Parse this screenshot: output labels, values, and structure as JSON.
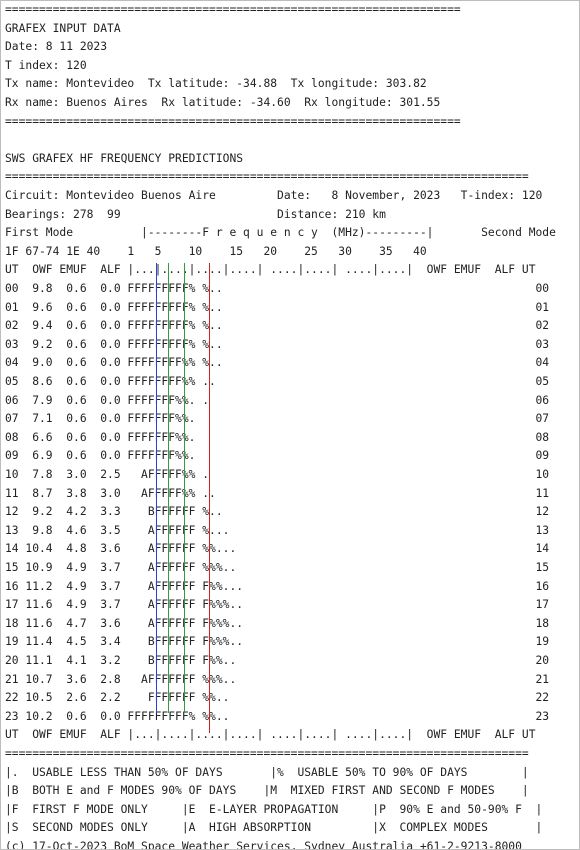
{
  "document": {
    "lines": [
      "===================================================================",
      "GRAFEX INPUT DATA",
      "Date: 8 11 2023",
      "T index: 120",
      "Tx name: Montevideo  Tx latitude: -34.88  Tx longitude: 303.82",
      "Rx name: Buenos Aires  Rx latitude: -34.60  Rx longitude: 301.55",
      "===================================================================",
      "",
      "SWS GRAFEX HF FREQUENCY PREDICTIONS",
      "=============================================================================",
      "Circuit: Montevideo Buenos Aire         Date:   8 November, 2023   T-index: 120",
      "Bearings: 278  99                       Distance: 210 km",
      "First Mode          |--------F r e q u e n c y  (MHz)---------|       Second Mode",
      "1F 67-74 1E 40    1   5    10    15   20    25   30    35   40",
      "UT  OWF EMUF  ALF |...|....|....|....| ....|....| ....|....|  OWF EMUF  ALF UT",
      "00  9.8  0.6  0.0 FFFFFFFFF% %..                                              00",
      "01  9.6  0.6  0.0 FFFFFFFFF% %..                                              01",
      "02  9.4  0.6  0.0 FFFFFFFFF% %..                                              02",
      "03  9.2  0.6  0.0 FFFFFFFFF% %..                                              03",
      "04  9.0  0.6  0.0 FFFFFFFF%% %..                                              04",
      "05  8.6  0.6  0.0 FFFFFFFF%% ..                                               05",
      "06  7.9  0.6  0.0 FFFFFFF%%. .                                                06",
      "07  7.1  0.6  0.0 FFFFFFF%%.                                                  07",
      "08  6.6  0.6  0.0 FFFFFFF%%.                                                  08",
      "09  6.9  0.6  0.0 FFFFFFF%%.                                                  09",
      "10  7.8  3.0  2.5   AFFFFF%% .                                                10",
      "11  8.7  3.8  3.0   AFFFFF%% ..                                               11",
      "12  9.2  4.2  3.3    BFFFFFF %..                                              12",
      "13  9.8  4.6  3.5    AFFFFFF %...                                             13",
      "14 10.4  4.8  3.6    AFFFFFF %%...                                            14",
      "15 10.9  4.9  3.7    AFFFFFF %%%..                                            15",
      "16 11.2  4.9  3.7    AFFFFFF F%%...                                           16",
      "17 11.6  4.9  3.7    AFFFFFF F%%%..                                           17",
      "18 11.6  4.7  3.6    AFFFFFF F%%%..                                           18",
      "19 11.4  4.5  3.4    BFFFFFF F%%%..                                           19",
      "20 11.1  4.1  3.2    BFFFFFF F%%..                                            20",
      "21 10.7  3.6  2.8   AFFFFFFF %%%..                                            21",
      "22 10.5  2.6  2.2    FFFFFFF %%..                                             22",
      "23 10.2  0.6  0.0 FFFFFFFFF% %%..                                             23",
      "UT  OWF EMUF  ALF |...|....|....|....| ....|....| ....|....|  OWF EMUF  ALF UT",
      "=============================================================================",
      "|.  USABLE LESS THAN 50% OF DAYS       |%  USABLE 50% TO 90% OF DAYS        |",
      "|B  BOTH E and F MODES 90% OF DAYS    |M  MIXED FIRST AND SECOND F MODES    |",
      "|F  FIRST F MODE ONLY     |E  E-LAYER PROPAGATION     |P  90% E and 50-90% F  |",
      "|S  SECOND MODES ONLY     |A  HIGH ABSORPTION         |X  COMPLEX MODES       |",
      "(c) 17-Oct-2023 BoM Space Weather Services, Sydney Australia +61-2-9213-8000"
    ],
    "colors": {
      "text": "#222222",
      "border": "#bdbdbd",
      "line_blue": "#2c3fd6",
      "line_green": "#2e9e3e",
      "line_red": "#d62020"
    }
  }
}
